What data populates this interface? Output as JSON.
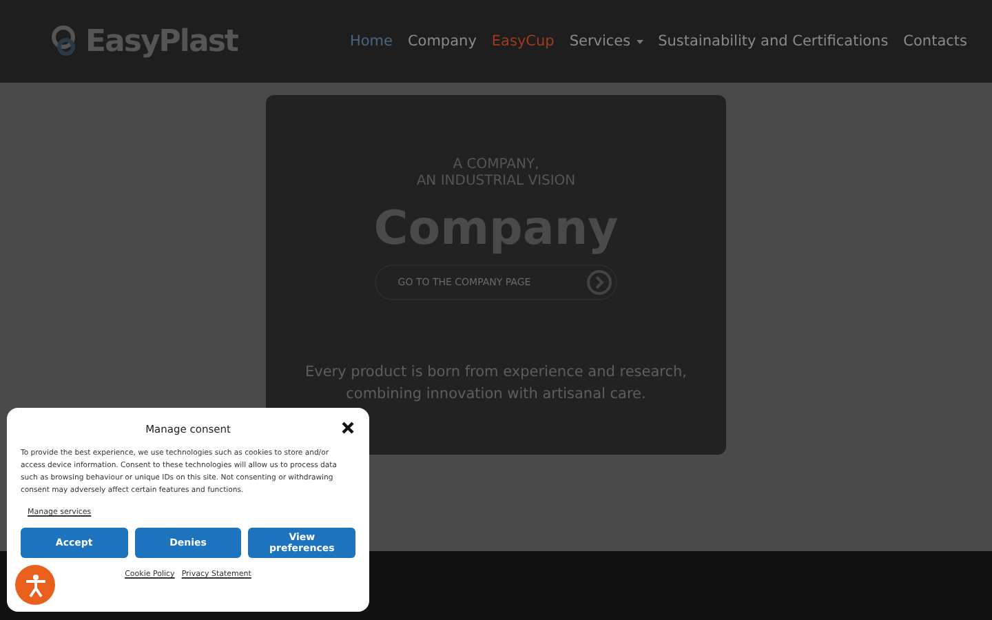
{
  "header": {
    "logo": "EasyPlast",
    "nav": [
      {
        "label": "Home",
        "kind": "current",
        "has_caret": false
      },
      {
        "label": "Company",
        "kind": "plain",
        "has_caret": false
      },
      {
        "label": "EasyCup",
        "kind": "accent",
        "has_caret": false
      },
      {
        "label": "Services",
        "kind": "plain",
        "has_caret": true
      },
      {
        "label": "Sustainability and Certifications",
        "kind": "plain",
        "has_caret": false
      },
      {
        "label": "Contacts",
        "kind": "plain",
        "has_caret": false
      }
    ]
  },
  "hero": {
    "eyebrow": [
      "A COMPANY,",
      "AN INDUSTRIAL VISION"
    ],
    "title": "Company",
    "cta": "GO TO THE COMPANY PAGE",
    "text": "Every product is born from experience and research, combining innovation with artisanal care."
  },
  "consent": {
    "title": "Manage consent",
    "body": "To provide the best experience, we use technologies such as cookies to store and/or access device information. Consent to these technologies will allow us to process data such as browsing behaviour or unique IDs on this site. Not consenting or withdrawing consent may adversely affect certain features and functions.",
    "manage": "Manage services",
    "buttons": [
      "Accept",
      "Denies",
      "View preferences"
    ],
    "links": [
      "Cookie Policy",
      "Privacy Statement"
    ]
  }
}
